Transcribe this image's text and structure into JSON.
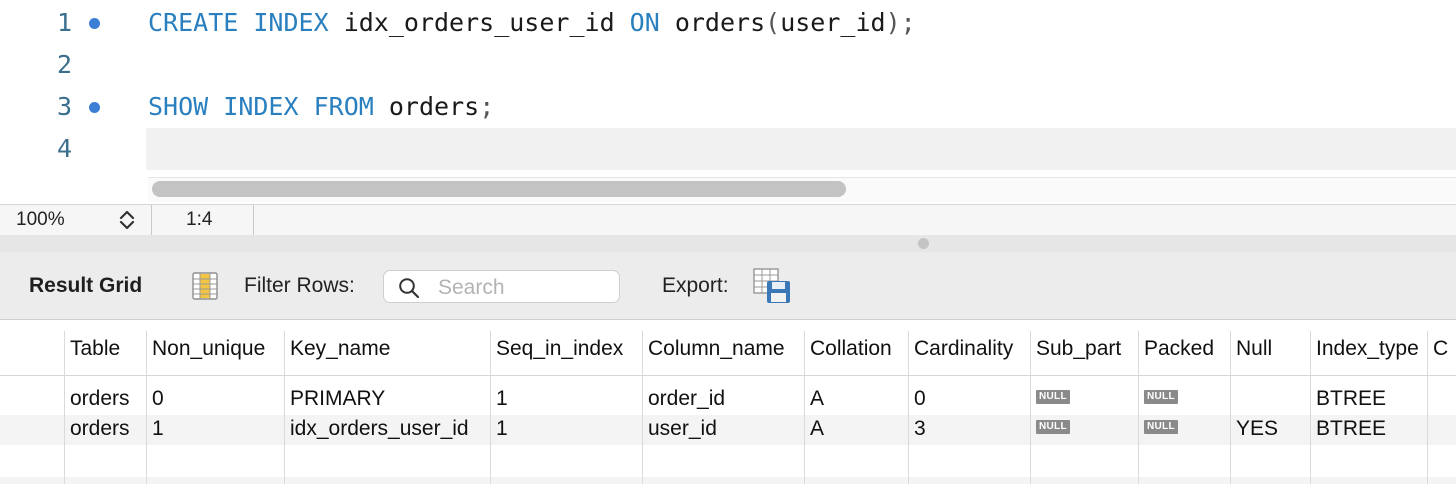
{
  "editor": {
    "lines": [
      {
        "number": "1",
        "has_statement_marker": true,
        "tokens": [
          {
            "text": "CREATE",
            "kind": "kw"
          },
          {
            "text": " ",
            "kind": "plain"
          },
          {
            "text": "INDEX",
            "kind": "kw"
          },
          {
            "text": " idx_orders_user_id ",
            "kind": "plain"
          },
          {
            "text": "ON",
            "kind": "kw"
          },
          {
            "text": " orders",
            "kind": "plain"
          },
          {
            "text": "(",
            "kind": "punct"
          },
          {
            "text": "user_id",
            "kind": "plain"
          },
          {
            "text": ");",
            "kind": "punct"
          }
        ]
      },
      {
        "number": "2",
        "has_statement_marker": false,
        "tokens": []
      },
      {
        "number": "3",
        "has_statement_marker": true,
        "tokens": [
          {
            "text": "SHOW",
            "kind": "kw"
          },
          {
            "text": " ",
            "kind": "plain"
          },
          {
            "text": "INDEX",
            "kind": "kw"
          },
          {
            "text": " ",
            "kind": "plain"
          },
          {
            "text": "FROM",
            "kind": "kw"
          },
          {
            "text": " orders",
            "kind": "plain"
          },
          {
            "text": ";",
            "kind": "punct"
          }
        ]
      },
      {
        "number": "4",
        "has_statement_marker": false,
        "tokens": []
      }
    ],
    "keyword_color": "#2a7fbf",
    "marker_color": "#3c7ed6"
  },
  "statusbar": {
    "zoom": "100%",
    "cursor_position": "1:4"
  },
  "result_toolbar": {
    "tab_label": "Result Grid",
    "filter_label": "Filter Rows:",
    "search_placeholder": "Search",
    "search_value": "",
    "export_label": "Export:"
  },
  "grid": {
    "columns": [
      "Table",
      "Non_unique",
      "Key_name",
      "Seq_in_index",
      "Column_name",
      "Collation",
      "Cardinality",
      "Sub_part",
      "Packed",
      "Null",
      "Index_type",
      "C"
    ],
    "rows": [
      [
        "orders",
        "0",
        "PRIMARY",
        "1",
        "order_id",
        "A",
        "0",
        "NULL",
        "NULL",
        "",
        "BTREE",
        ""
      ],
      [
        "orders",
        "1",
        "idx_orders_user_id",
        "1",
        "user_id",
        "A",
        "3",
        "NULL",
        "NULL",
        "YES",
        "BTREE",
        ""
      ]
    ],
    "null_badge_text": "NULL"
  }
}
